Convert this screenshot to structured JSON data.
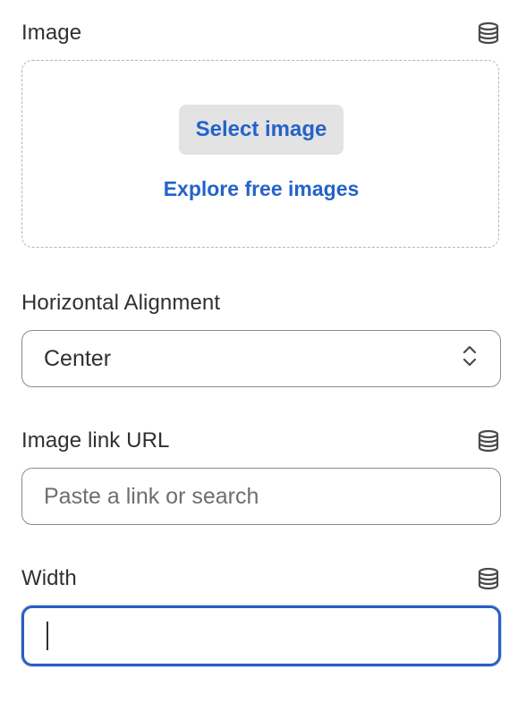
{
  "image_section": {
    "label": "Image",
    "icon": "database-icon",
    "select_button": "Select image",
    "explore_link": "Explore free images"
  },
  "alignment_section": {
    "label": "Horizontal Alignment",
    "selected": "Center",
    "icon": "chevron-up-down-icon"
  },
  "link_section": {
    "label": "Image link URL",
    "icon": "database-icon",
    "placeholder": "Paste a link or search",
    "value": ""
  },
  "width_section": {
    "label": "Width",
    "icon": "database-icon",
    "value": "",
    "focused": true
  },
  "colors": {
    "link_blue": "#2463c9",
    "focus_blue": "#2b5fc1",
    "button_bg": "#e3e3e3"
  }
}
